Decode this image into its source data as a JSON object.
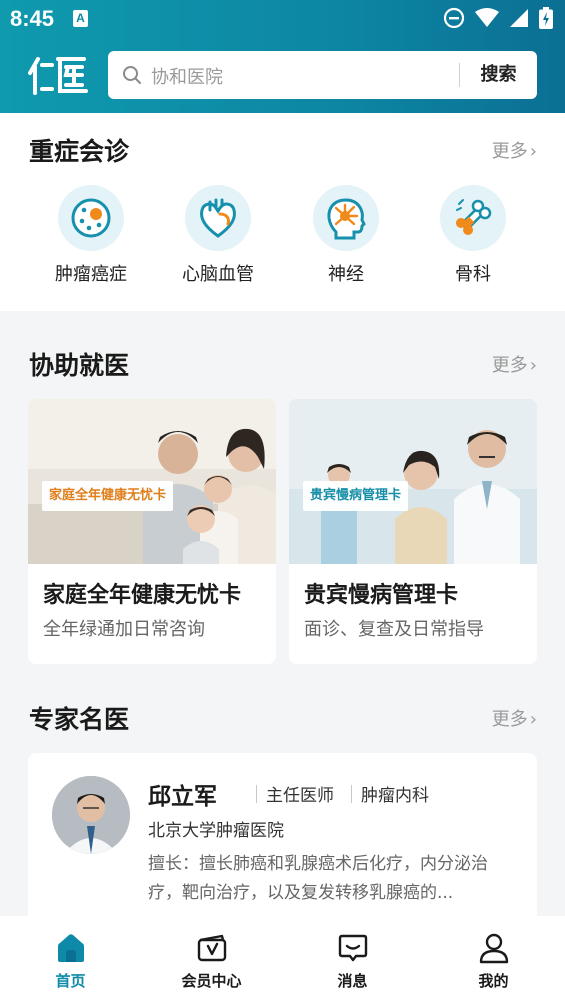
{
  "status_bar": {
    "time": "8:45",
    "notification_badge": "A"
  },
  "header": {
    "logo_alt": "仁医",
    "search_placeholder": "协和医院",
    "search_button": "搜索",
    "accent_color": "#0d8aa5"
  },
  "critical_care": {
    "title": "重症会诊",
    "more": "更多",
    "categories": [
      {
        "label": "肿瘤癌症",
        "icon": "tumor-cell-icon"
      },
      {
        "label": "心脑血管",
        "icon": "heart-icon"
      },
      {
        "label": "神经",
        "icon": "brain-neuron-icon"
      },
      {
        "label": "骨科",
        "icon": "bone-icon"
      }
    ]
  },
  "assist": {
    "title": "协助就医",
    "more": "更多",
    "cards": [
      {
        "tag": "家庭全年健康无忧卡",
        "title": "家庭全年健康无忧卡",
        "subtitle": "全年绿通加日常咨询",
        "tag_color": "#e07a10"
      },
      {
        "tag": "贵宾慢病管理卡",
        "title": "贵宾慢病管理卡",
        "subtitle": "面诊、复查及日常指导",
        "tag_color": "#0d8aa5"
      }
    ]
  },
  "experts": {
    "title": "专家名医",
    "more": "更多",
    "doctor": {
      "name": "邱立军",
      "title": "主任医师",
      "department": "肿瘤内科",
      "hospital": "北京大学肿瘤医院",
      "specialty": "擅长：擅长肺癌和乳腺癌术后化疗，内分泌治疗，靶向治疗，以及复发转移乳腺癌的..."
    }
  },
  "bottom_nav": [
    {
      "label": "首页",
      "icon": "home-icon",
      "active": true
    },
    {
      "label": "会员中心",
      "icon": "member-card-icon",
      "active": false
    },
    {
      "label": "消息",
      "icon": "message-icon",
      "active": false
    },
    {
      "label": "我的",
      "icon": "profile-icon",
      "active": false
    }
  ]
}
